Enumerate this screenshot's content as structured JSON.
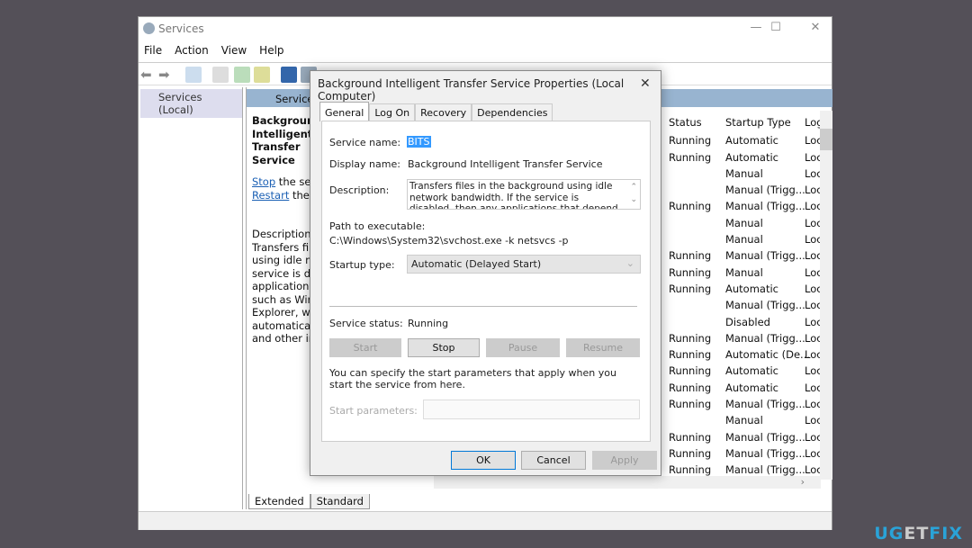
{
  "window": {
    "title": "Services",
    "menu": [
      "File",
      "Action",
      "View",
      "Help"
    ]
  },
  "tree": {
    "root": "Services (Local)"
  },
  "pane": {
    "header": "Services",
    "selected_title": "Background Intelligent Transfer Service",
    "stop_link": "Stop",
    "stop_rest": " the service",
    "restart_link": "Restart",
    "restart_rest": " the service",
    "desc_label": "Description:",
    "desc_lines": [
      "Transfers files in the",
      "using idle network",
      "service is disabled,",
      "applications that",
      "such as Windows",
      "Explorer, will",
      "automatically",
      "and other info"
    ]
  },
  "list": {
    "columns": [
      "Status",
      "Startup Type",
      "Log On As"
    ],
    "rows": [
      [
        "Running",
        "Automatic",
        "Loc"
      ],
      [
        "Running",
        "Automatic",
        "Loc"
      ],
      [
        "",
        "Manual",
        "Loc"
      ],
      [
        "",
        "Manual (Trigg...",
        "Loc"
      ],
      [
        "Running",
        "Manual (Trigg...",
        "Loc"
      ],
      [
        "",
        "Manual",
        "Loc"
      ],
      [
        "",
        "Manual",
        "Loc"
      ],
      [
        "Running",
        "Manual (Trigg...",
        "Loc"
      ],
      [
        "Running",
        "Manual",
        "Loc"
      ],
      [
        "Running",
        "Automatic",
        "Loc"
      ],
      [
        "",
        "Manual (Trigg...",
        "Loc"
      ],
      [
        "",
        "Disabled",
        "Loc"
      ],
      [
        "Running",
        "Manual (Trigg...",
        "Loc"
      ],
      [
        "Running",
        "Automatic (De...",
        "Loc"
      ],
      [
        "Running",
        "Automatic",
        "Loc"
      ],
      [
        "Running",
        "Automatic",
        "Loc"
      ],
      [
        "Running",
        "Manual (Trigg...",
        "Loc"
      ],
      [
        "",
        "Manual",
        "Loc"
      ],
      [
        "Running",
        "Manual (Trigg...",
        "Loc"
      ],
      [
        "Running",
        "Manual (Trigg...",
        "Loc"
      ],
      [
        "Running",
        "Manual (Trigg...",
        "Loc"
      ]
    ],
    "highlighted_row": 13
  },
  "bottom_tabs": [
    "Extended",
    "Standard"
  ],
  "dialog": {
    "title": "Background Intelligent Transfer Service Properties (Local Computer)",
    "tabs": [
      "General",
      "Log On",
      "Recovery",
      "Dependencies"
    ],
    "active_tab": "General",
    "service_name_label": "Service name:",
    "service_name": "BITS",
    "display_name_label": "Display name:",
    "display_name": "Background Intelligent Transfer Service",
    "description_label": "Description:",
    "description": "Transfers files in the background using idle network bandwidth. If the service is disabled, then any applications that depend on BITS, such as Windows",
    "path_label": "Path to executable:",
    "path": "C:\\Windows\\System32\\svchost.exe -k netsvcs -p",
    "startup_label": "Startup type:",
    "startup_value": "Automatic (Delayed Start)",
    "status_label": "Service status:",
    "status_value": "Running",
    "buttons": {
      "start": "Start",
      "stop": "Stop",
      "pause": "Pause",
      "resume": "Resume"
    },
    "hint": "You can specify the start parameters that apply when you start the service from here.",
    "params_label": "Start parameters:",
    "params_value": "",
    "ok": "OK",
    "cancel": "Cancel",
    "apply": "Apply"
  },
  "watermark": "UGETFIX",
  "colors": {
    "header": "#98b4d0",
    "selection": "#3399ff",
    "watermark_blue": "#2aa3d8"
  }
}
